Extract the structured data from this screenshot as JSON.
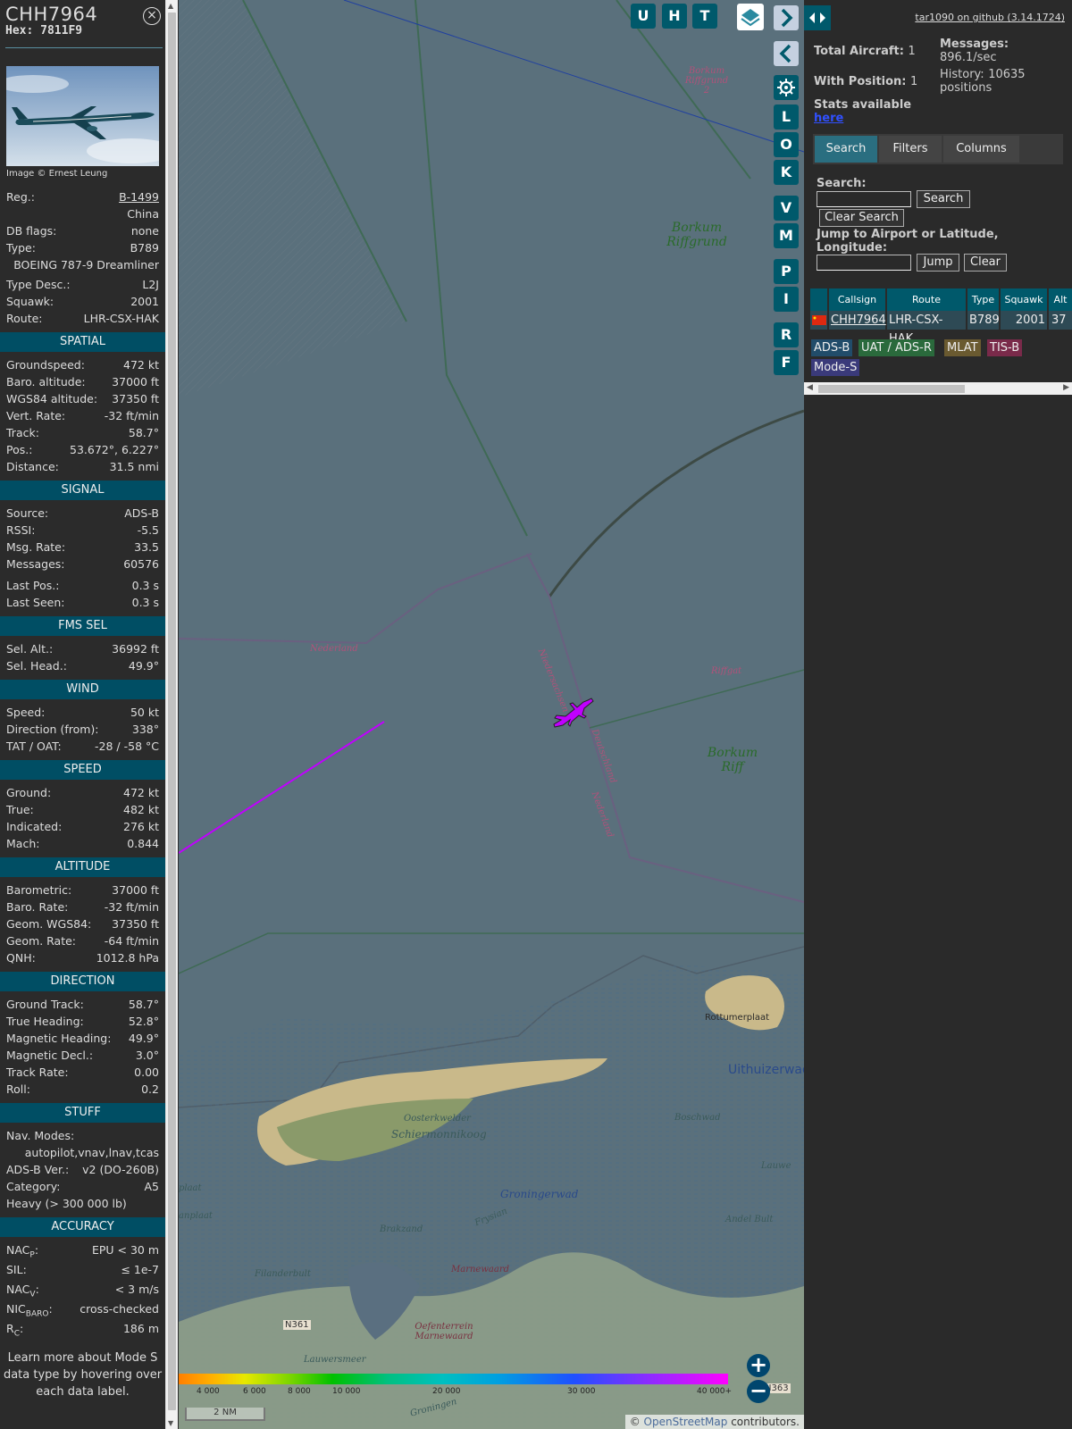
{
  "aircraft": {
    "callsign": "CHH7964",
    "hex": "Hex: 7811F9",
    "image_credit": "Image © Ernest Leung",
    "reg_label": "Reg.:",
    "reg": "B-1499",
    "country": "China",
    "db_flags_label": "DB flags:",
    "db_flags": "none",
    "type_label": "Type:",
    "type": "B789",
    "type_full": "BOEING 787-9 Dreamliner",
    "type_desc_label": "Type Desc.:",
    "type_desc": "L2J",
    "squawk_label": "Squawk:",
    "squawk": "2001",
    "route_label": "Route:",
    "route": "LHR-CSX-HAK"
  },
  "sections": {
    "spatial": "SPATIAL",
    "signal": "SIGNAL",
    "fms": "FMS SEL",
    "wind": "WIND",
    "speed": "SPEED",
    "altitude": "ALTITUDE",
    "direction": "DIRECTION",
    "stuff": "STUFF",
    "accuracy": "ACCURACY"
  },
  "spatial": [
    {
      "k": "Groundspeed:",
      "v": "472 kt"
    },
    {
      "k": "Baro. altitude:",
      "v": "37000 ft"
    },
    {
      "k": "WGS84 altitude:",
      "v": "37350 ft"
    },
    {
      "k": "Vert. Rate:",
      "v": "-32 ft/min"
    },
    {
      "k": "Track:",
      "v": "58.7°"
    },
    {
      "k": "Pos.:",
      "v": "53.672°, 6.227°"
    },
    {
      "k": "Distance:",
      "v": "31.5 nmi"
    }
  ],
  "signal": [
    {
      "k": "Source:",
      "v": "ADS-B"
    },
    {
      "k": "RSSI:",
      "v": "-5.5"
    },
    {
      "k": "Msg. Rate:",
      "v": "33.5"
    },
    {
      "k": "Messages:",
      "v": "60576"
    },
    {
      "k": "Last Pos.:",
      "v": "0.3 s"
    },
    {
      "k": "Last Seen:",
      "v": "0.3 s"
    }
  ],
  "fms": [
    {
      "k": "Sel. Alt.:",
      "v": "36992 ft"
    },
    {
      "k": "Sel. Head.:",
      "v": "49.9°"
    }
  ],
  "wind": [
    {
      "k": "Speed:",
      "v": "50 kt"
    },
    {
      "k": "Direction (from):",
      "v": "338°"
    },
    {
      "k": "TAT / OAT:",
      "v": "-28 / -58 °C"
    }
  ],
  "speed": [
    {
      "k": "Ground:",
      "v": "472 kt"
    },
    {
      "k": "True:",
      "v": "482 kt"
    },
    {
      "k": "Indicated:",
      "v": "276 kt"
    },
    {
      "k": "Mach:",
      "v": "0.844"
    }
  ],
  "altitude": [
    {
      "k": "Barometric:",
      "v": "37000 ft"
    },
    {
      "k": "Baro. Rate:",
      "v": "-32 ft/min"
    },
    {
      "k": "Geom. WGS84:",
      "v": "37350 ft"
    },
    {
      "k": "Geom. Rate:",
      "v": "-64 ft/min"
    },
    {
      "k": "QNH:",
      "v": "1012.8 hPa"
    }
  ],
  "direction": [
    {
      "k": "Ground Track:",
      "v": "58.7°"
    },
    {
      "k": "True Heading:",
      "v": "52.8°"
    },
    {
      "k": "Magnetic Heading:",
      "v": "49.9°"
    },
    {
      "k": "Magnetic Decl.:",
      "v": "3.0°"
    },
    {
      "k": "Track Rate:",
      "v": "0.00"
    },
    {
      "k": "Roll:",
      "v": "0.2"
    }
  ],
  "stuff": {
    "nav_modes_label": "Nav. Modes:",
    "nav_modes": "autopilot,vnav,lnav,tcas",
    "adsb_ver_label": "ADS-B Ver.:",
    "adsb_ver": "v2 (DO-260B)",
    "category_label": "Category:",
    "category": "A5",
    "category_desc": "Heavy (> 300 000 lb)"
  },
  "accuracy": {
    "nacp_label": "NAC",
    "nacp_sub": "P",
    "nacp": "EPU < 30 m",
    "sil_label": "SIL:",
    "sil": "≤ 1e-7",
    "nacv_label": "NAC",
    "nacv_sub": "V",
    "nacv": "< 3 m/s",
    "nicbaro_label": "NIC",
    "nicbaro_sub": "BARO",
    "nicbaro": "cross-checked",
    "rc_label": "R",
    "rc_sub": "C",
    "rc": "186 m"
  },
  "footer_note": "Learn more about Mode S data type by hovering over each data label.",
  "map": {
    "buttons_top": [
      "U",
      "H",
      "T"
    ],
    "buttons_side": [
      "L",
      "O",
      "K",
      "V",
      "M",
      "P",
      "I",
      "R",
      "F"
    ],
    "labels": {
      "borkum_riffgrund_2": "Borkum Riffgrund 2",
      "borkum_riffgrund": "Borkum Riffgrund",
      "nederland": "Nederland",
      "niedersachsen": "Niedersachsen",
      "deutschland": "Deutschland",
      "nederland2": "Nederland",
      "riffgat": "Riffgat",
      "borkum_riff": "Borkum Riff",
      "rottumerplaat": "Rottumerplaat",
      "uithuizerwad": "Uithuizerwad",
      "oosterkwelder": "Oosterkwelder",
      "schiermonnikoog": "Schiermonnikoog",
      "boschwad": "Boschwad",
      "groningerwad": "Groningerwad",
      "brakzand": "Brakzand",
      "frysian": "Frysian",
      "engelsmanplaat": "plaat",
      "engelsmanplaat2": "anplaat",
      "andel_bult": "Andel Bult",
      "marnewaard": "Marnewaard",
      "filanderbult": "Filanderbult",
      "oefenterrein": "Oefenterrein Marnewaard",
      "lauwersmeer": "Lauwersmeer",
      "n361": "N361",
      "n363": "N363",
      "lauw": "Lauwe",
      "groningen": "Groningen"
    },
    "alt_ticks": [
      "4 000",
      "6 000",
      "8 000",
      "10 000",
      "20 000",
      "30 000",
      "40 000+"
    ],
    "scale": "2 NM",
    "attribution_prefix": "© ",
    "attribution_link": "OpenStreetMap",
    "attribution_suffix": " contributors."
  },
  "right": {
    "github": "tar1090 on github (3.14.1724)",
    "total_aircraft_label": "Total Aircraft:",
    "total_aircraft": "1",
    "with_position_label": "With Position:",
    "with_position": "1",
    "stats_label": "Stats available",
    "stats_link": "here",
    "messages_label": "Messages:",
    "messages": "896.1/sec",
    "history_label": "History:",
    "history": "10635 positions",
    "tabs": [
      "Search",
      "Filters",
      "Columns"
    ],
    "search_label": "Search:",
    "search_btn": "Search",
    "clear_search_btn": "Clear Search",
    "jump_label": "Jump to Airport or Latitude, Longitude:",
    "jump_btn": "Jump",
    "clear_btn": "Clear",
    "table_headers": [
      "Callsign",
      "Route",
      "Type",
      "Squawk",
      "Alt"
    ],
    "table_row": {
      "callsign": "CHH7964",
      "route": "LHR-CSX-HAK",
      "type": "B789",
      "squawk": "2001",
      "alt": "37"
    },
    "legend": [
      "ADS-B",
      "UAT / ADS-R",
      "MLAT",
      "TIS-B",
      "Mode-S"
    ]
  },
  "colors": {
    "section_bg": "#004e64",
    "button_bg": "#00596b",
    "aircraft": "#c000ff",
    "track": "#c000ff",
    "map_water": "#5a707c"
  }
}
